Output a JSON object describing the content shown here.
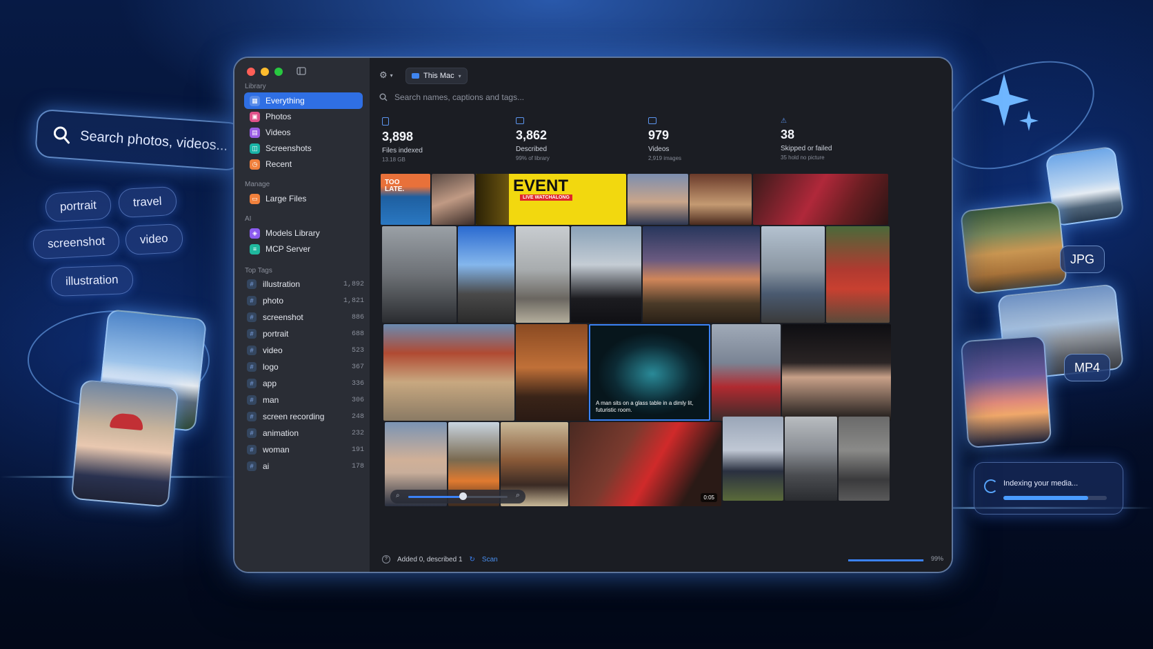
{
  "floating": {
    "search_placeholder": "Search photos, videos...",
    "chips": [
      "portrait",
      "travel",
      "screenshot",
      "video",
      "illustration"
    ],
    "format_badges": [
      "JPG",
      "MP4"
    ],
    "indexing_label": "Indexing your media...",
    "indexing_progress": 0.82
  },
  "window": {
    "location": "This Mac",
    "search_placeholder": "Search names, captions and tags..."
  },
  "sidebar": {
    "library_heading": "Library",
    "library_items": [
      {
        "label": "Everything",
        "icon": "grid-icon",
        "color": "#2f6fe4"
      },
      {
        "label": "Photos",
        "icon": "photo-icon",
        "color": "#e0528a"
      },
      {
        "label": "Videos",
        "icon": "film-icon",
        "color": "#9b5de5"
      },
      {
        "label": "Screenshots",
        "icon": "screenshot-icon",
        "color": "#19b3a6"
      },
      {
        "label": "Recent",
        "icon": "clock-icon",
        "color": "#f0803c"
      }
    ],
    "manage_heading": "Manage",
    "manage_items": [
      {
        "label": "Large Files",
        "icon": "drive-icon",
        "color": "#f0803c"
      }
    ],
    "ai_heading": "AI",
    "ai_items": [
      {
        "label": "Models Library",
        "icon": "cube-icon",
        "color": "#8c5cf0"
      },
      {
        "label": "MCP Server",
        "icon": "server-icon",
        "color": "#1fb89e"
      }
    ],
    "tags_heading": "Top Tags",
    "tags": [
      {
        "name": "illustration",
        "count": "1,892"
      },
      {
        "name": "photo",
        "count": "1,821"
      },
      {
        "name": "screenshot",
        "count": "886"
      },
      {
        "name": "portrait",
        "count": "688"
      },
      {
        "name": "video",
        "count": "523"
      },
      {
        "name": "logo",
        "count": "367"
      },
      {
        "name": "app",
        "count": "336"
      },
      {
        "name": "man",
        "count": "306"
      },
      {
        "name": "screen recording",
        "count": "248"
      },
      {
        "name": "animation",
        "count": "232"
      },
      {
        "name": "woman",
        "count": "191"
      },
      {
        "name": "ai",
        "count": "178"
      }
    ]
  },
  "stats": [
    {
      "value": "3,898",
      "label": "Files indexed",
      "sub": "13.18 GB"
    },
    {
      "value": "3,862",
      "label": "Described",
      "sub": "99% of library"
    },
    {
      "value": "979",
      "label": "Videos",
      "sub": "2,919 images"
    },
    {
      "value": "38",
      "label": "Skipped or failed",
      "sub": "35 hold no picture"
    }
  ],
  "grid": {
    "poster_small": "TOO LATE.",
    "poster_big": "EVENT",
    "poster_tag": "LIVE WATCHALONG",
    "caption": "A man sits on a glass table in a dimly lit, futuristic room.",
    "duration": "0:05"
  },
  "status": {
    "message": "Added 0, described 1",
    "scan_label": "Scan",
    "progress_label": "99%"
  },
  "colors": {
    "accent": "#2f6fe4",
    "glow": "#5aa0ff"
  }
}
